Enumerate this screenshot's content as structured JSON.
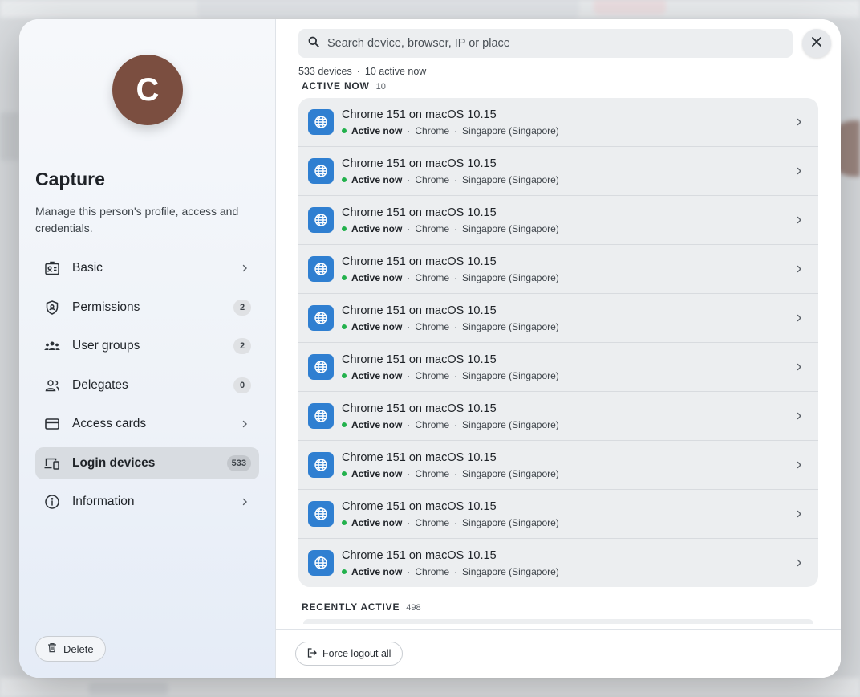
{
  "user": {
    "initial": "C",
    "name": "Capture",
    "description": "Manage this person's profile, access and credentials."
  },
  "nav": [
    {
      "label": "Basic",
      "icon": "id-card-icon",
      "badge": null
    },
    {
      "label": "Permissions",
      "icon": "shield-icon",
      "badge": "2"
    },
    {
      "label": "User groups",
      "icon": "users-icon",
      "badge": "2"
    },
    {
      "label": "Delegates",
      "icon": "delegate-icon",
      "badge": "0"
    },
    {
      "label": "Access cards",
      "icon": "card-icon",
      "badge": null
    },
    {
      "label": "Login devices",
      "icon": "devices-icon",
      "badge": "533",
      "active": true
    },
    {
      "label": "Information",
      "icon": "info-icon",
      "badge": null
    }
  ],
  "actions": {
    "delete_label": "Delete",
    "force_logout_label": "Force logout all"
  },
  "search": {
    "placeholder": "Search device, browser, IP or place"
  },
  "summary": {
    "devices": "533 devices",
    "separator": "·",
    "active": "10 active now"
  },
  "sections": {
    "active": {
      "title": "ACTIVE NOW",
      "count": "10"
    },
    "recent": {
      "title": "RECENTLY ACTIVE",
      "count": "498"
    }
  },
  "devices": [
    {
      "title": "Chrome 151 on macOS 10.15",
      "status": "Active now",
      "browser": "Chrome",
      "place": "Singapore (Singapore)"
    },
    {
      "title": "Chrome 151 on macOS 10.15",
      "status": "Active now",
      "browser": "Chrome",
      "place": "Singapore (Singapore)"
    },
    {
      "title": "Chrome 151 on macOS 10.15",
      "status": "Active now",
      "browser": "Chrome",
      "place": "Singapore (Singapore)"
    },
    {
      "title": "Chrome 151 on macOS 10.15",
      "status": "Active now",
      "browser": "Chrome",
      "place": "Singapore (Singapore)"
    },
    {
      "title": "Chrome 151 on macOS 10.15",
      "status": "Active now",
      "browser": "Chrome",
      "place": "Singapore (Singapore)"
    },
    {
      "title": "Chrome 151 on macOS 10.15",
      "status": "Active now",
      "browser": "Chrome",
      "place": "Singapore (Singapore)"
    },
    {
      "title": "Chrome 151 on macOS 10.15",
      "status": "Active now",
      "browser": "Chrome",
      "place": "Singapore (Singapore)"
    },
    {
      "title": "Chrome 151 on macOS 10.15",
      "status": "Active now",
      "browser": "Chrome",
      "place": "Singapore (Singapore)"
    },
    {
      "title": "Chrome 151 on macOS 10.15",
      "status": "Active now",
      "browser": "Chrome",
      "place": "Singapore (Singapore)"
    },
    {
      "title": "Chrome 151 on macOS 10.15",
      "status": "Active now",
      "browser": "Chrome",
      "place": "Singapore (Singapore)"
    }
  ],
  "colors": {
    "accent": "#2f7fd1",
    "active_dot": "#22b14c",
    "avatar": "#7b4e40"
  }
}
